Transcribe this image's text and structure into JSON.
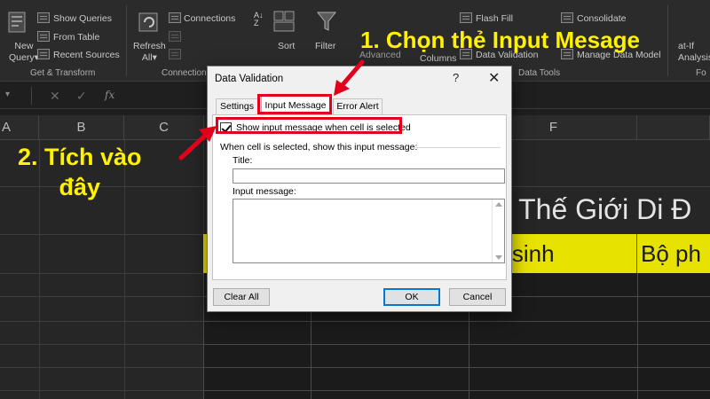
{
  "ribbon": {
    "new_query": [
      "New",
      "Query"
    ],
    "show_queries": "Show Queries",
    "from_table": "From Table",
    "recent_sources": "Recent Sources",
    "group_get_transform": "Get & Transform",
    "refresh_all": [
      "Refresh",
      "All"
    ],
    "connections": "Connections",
    "group_connections": "Connection",
    "sort": "Sort",
    "filter": "Filter",
    "advanced": "Advanced",
    "columns": "Columns",
    "flash_fill": "Flash Fill",
    "data_validation": "Data Validation",
    "consolidate": "Consolidate",
    "manage_data_model": "Manage Data Model",
    "group_data_tools": "Data Tools",
    "what_if": [
      "at-If",
      "Analysis"
    ],
    "group_fo": "Fo"
  },
  "sheet": {
    "columns": [
      "A",
      "B",
      "C",
      "F"
    ],
    "title_fragment": "n Thế Giới Di Đ",
    "header_cells": [
      "m sinh",
      "Bộ ph"
    ]
  },
  "dialog": {
    "title": "Data Validation",
    "help": "?",
    "close": "✕",
    "tabs": [
      "Settings",
      "Input Message",
      "Error Alert"
    ],
    "checkbox_label": "Show input message when cell is selected",
    "checkbox_checked": true,
    "section_label": "When cell is selected, show this input message:",
    "title_label": "Title:",
    "title_value": "",
    "message_label": "Input message:",
    "message_value": "",
    "buttons": {
      "clear_all": "Clear All",
      "ok": "OK",
      "cancel": "Cancel"
    }
  },
  "annotations": {
    "step1": "1. Chọn thẻ Input Mesage",
    "step2_line1": "2. Tích vào",
    "step2_line2": "đây"
  },
  "colors": {
    "annotation_text": "#fff200",
    "annotation_box": "#e3001b",
    "header_fill": "#e8e200",
    "ok_border": "#0078d7"
  }
}
